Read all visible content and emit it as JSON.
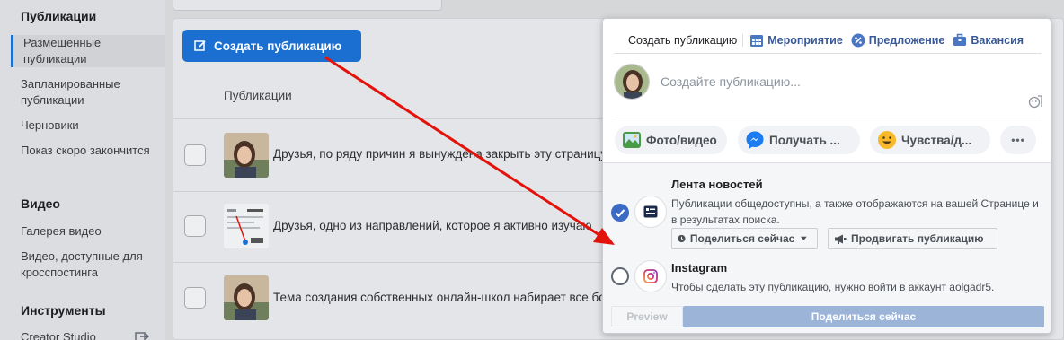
{
  "sidebar": {
    "section_publications": "Публикации",
    "items_publications": [
      {
        "label": "Размещенные публикации",
        "active": true
      },
      {
        "label": "Запланированные публикации"
      },
      {
        "label": "Черновики"
      },
      {
        "label": "Показ скоро закончится"
      }
    ],
    "section_video": "Видео",
    "items_video": [
      {
        "label": "Галерея видео"
      },
      {
        "label": "Видео, доступные для кросспостинга"
      }
    ],
    "section_tools": "Инструменты",
    "items_tools": [
      {
        "label": "Creator Studio",
        "icon": "external-link-icon"
      }
    ]
  },
  "main": {
    "create_button": "Создать публикацию",
    "column_header": "Публикации",
    "posts": [
      {
        "text": "Друзья, по ряду причин я вынуждена закрыть эту страницу"
      },
      {
        "text": "Друзья, одно из направлений, которое я активно изучаю"
      },
      {
        "text": "Тема создания собственных онлайн-школ набирает все большие"
      }
    ]
  },
  "composer": {
    "tabs": [
      {
        "label": "Создать публикацию",
        "icon": ""
      },
      {
        "label": "Мероприятие",
        "icon": "calendar-icon"
      },
      {
        "label": "Предложение",
        "icon": "percent-badge-icon"
      },
      {
        "label": "Вакансия",
        "icon": "briefcase-icon"
      }
    ],
    "placeholder": "Создайте публикацию...",
    "chips": [
      {
        "label": "Фото/видео",
        "icon": "photo-icon"
      },
      {
        "label": "Получать ...",
        "icon": "messenger-icon"
      },
      {
        "label": "Чувства/д...",
        "icon": "smiley-icon"
      },
      {
        "label": "•••",
        "icon": "more-icon"
      }
    ],
    "newsfeed": {
      "title": "Лента новостей",
      "description": "Публикации общедоступны, а также отображаются на вашей Странице и в результатах поиска.",
      "share_now": "Поделиться сейчас",
      "boost": "Продвигать публикацию",
      "checked": true
    },
    "instagram": {
      "title": "Instagram",
      "description": "Чтобы сделать эту публикацию, нужно войти в аккаунт aolgadr5.",
      "checked": false
    },
    "preview_button": "Preview",
    "share_button": "Поделиться сейчас"
  },
  "colors": {
    "accent": "#1b6fd1",
    "link": "#385898",
    "annotation_arrow": "#e3120b"
  }
}
